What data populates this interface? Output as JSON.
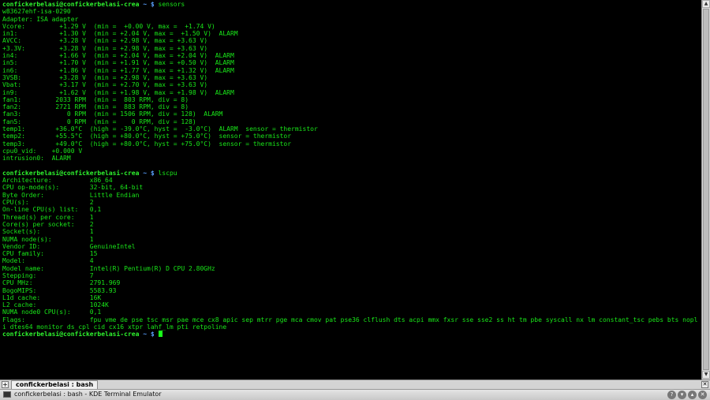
{
  "terminal": {
    "sensors_command": "sensors",
    "lscpu_command": "lscpu",
    "prompt": {
      "user_host": "confickerbelasi@confickerbelasi-crea",
      "path": "~",
      "symbol": "$"
    },
    "sensors_output": [
      "w83627ehf-isa-0290",
      "Adapter: ISA adapter",
      "Vcore:         +1.29 V  (min =  +0.00 V, max =  +1.74 V)",
      "in1:           +1.30 V  (min = +2.04 V, max =  +1.50 V)  ALARM",
      "AVCC:          +3.28 V  (min = +2.98 V, max = +3.63 V)",
      "+3.3V:         +3.28 V  (min = +2.98 V, max = +3.63 V)",
      "in4:           +1.66 V  (min = +2.04 V, max = +2.04 V)  ALARM",
      "in5:           +1.70 V  (min = +1.91 V, max = +0.50 V)  ALARM",
      "in6:           +1.86 V  (min = +1.77 V, max = +1.32 V)  ALARM",
      "3VSB:          +3.28 V  (min = +2.98 V, max = +3.63 V)",
      "Vbat:          +3.17 V  (min = +2.70 V, max = +3.63 V)",
      "in9:           +1.62 V  (min = +1.98 V, max = +1.98 V)  ALARM",
      "fan1:         2033 RPM  (min =  803 RPM, div = 8)",
      "fan2:         2721 RPM  (min =  883 RPM, div = 8)",
      "fan3:            0 RPM  (min = 1506 RPM, div = 128)  ALARM",
      "fan5:            0 RPM  (min =    0 RPM, div = 128)",
      "temp1:        +36.0°C  (high = -39.0°C, hyst =  -3.0°C)  ALARM  sensor = thermistor",
      "temp2:        +55.5°C  (high = +80.0°C, hyst = +75.0°C)  sensor = thermistor",
      "temp3:        +49.0°C  (high = +80.0°C, hyst = +75.0°C)  sensor = thermistor",
      "cpu0_vid:    +0.000 V",
      "intrusion0:  ALARM"
    ],
    "lscpu_output": [
      "Architecture:          x86_64",
      "CPU op-mode(s):        32-bit, 64-bit",
      "Byte Order:            Little Endian",
      "CPU(s):                2",
      "On-line CPU(s) list:   0,1",
      "Thread(s) per core:    1",
      "Core(s) per socket:    2",
      "Socket(s):             1",
      "NUMA node(s):          1",
      "Vendor ID:             GenuineIntel",
      "CPU family:            15",
      "Model:                 4",
      "Model name:            Intel(R) Pentium(R) D CPU 2.80GHz",
      "Stepping:              7",
      "CPU MHz:               2791.969",
      "BogoMIPS:              5583.93",
      "L1d cache:             16K",
      "L2 cache:              1024K",
      "NUMA node0 CPU(s):     0,1",
      "Flags:                 fpu vme de pse tsc msr pae mce cx8 apic sep mtrr pge mca cmov pat pse36 clflush dts acpi mmx fxsr sse sse2 ss ht tm pbe syscall nx lm constant_tsc pebs bts nopl cpuid pn",
      "i dtes64 monitor ds_cpl cid cx16 xtpr lahf_lm pti retpoline"
    ]
  },
  "tabs": {
    "new_tab_icon": "plus-icon",
    "active_tab_label": "confickerbelasi : bash",
    "close_icon": "close-icon"
  },
  "window": {
    "title": "confickerbelasi : bash - KDE Terminal Emulator",
    "buttons": [
      "help-icon",
      "minimize-icon",
      "maximize-icon",
      "close-icon"
    ],
    "accent_colors": {
      "terminal_text": "#19e619",
      "terminal_bg": "#000000",
      "prompt_user": "#2ef22e",
      "prompt_path": "#5aa0ff"
    }
  }
}
